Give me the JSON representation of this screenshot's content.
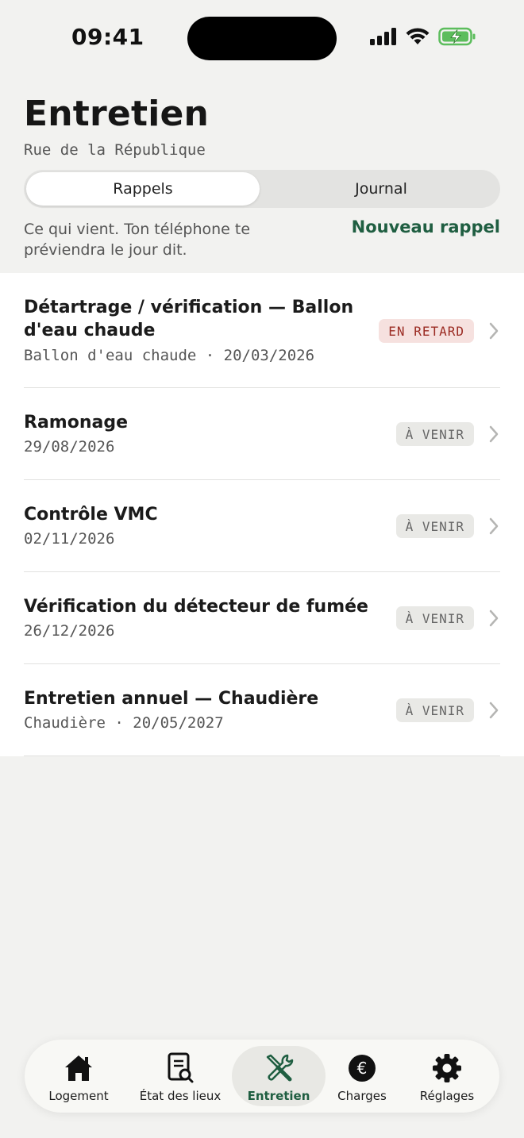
{
  "status_bar": {
    "time": "09:41"
  },
  "header": {
    "title": "Entretien",
    "subtitle": "Rue de la République"
  },
  "segmented": {
    "tabs": [
      {
        "label": "Rappels",
        "active": true
      },
      {
        "label": "Journal",
        "active": false
      }
    ]
  },
  "info": {
    "text": "Ce qui vient. Ton téléphone te préviendra le jour dit.",
    "new_reminder_label": "Nouveau rappel"
  },
  "reminders": [
    {
      "title": "Détartrage / vérification — Ballon d'eau chaude",
      "subtitle": "Ballon d'eau chaude · 20/03/2026",
      "status": "EN RETARD",
      "status_type": "late"
    },
    {
      "title": "Ramonage",
      "subtitle": "29/08/2026",
      "status": "À VENIR",
      "status_type": "upcoming"
    },
    {
      "title": "Contrôle VMC",
      "subtitle": "02/11/2026",
      "status": "À VENIR",
      "status_type": "upcoming"
    },
    {
      "title": "Vérification du détecteur de fumée",
      "subtitle": "26/12/2026",
      "status": "À VENIR",
      "status_type": "upcoming"
    },
    {
      "title": "Entretien annuel — Chaudière",
      "subtitle": "Chaudière · 20/05/2027",
      "status": "À VENIR",
      "status_type": "upcoming"
    }
  ],
  "tab_bar": {
    "items": [
      {
        "label": "Logement",
        "icon": "house-icon"
      },
      {
        "label": "État des lieux",
        "icon": "document-search-icon"
      },
      {
        "label": "Entretien",
        "icon": "tools-icon",
        "active": true
      },
      {
        "label": "Charges",
        "icon": "euro-icon"
      },
      {
        "label": "Réglages",
        "icon": "gear-icon"
      }
    ]
  },
  "colors": {
    "accent": "#1f5e41",
    "late_bg": "#f6e1df",
    "late_text": "#9b2b23",
    "background": "#f2f2f0"
  }
}
